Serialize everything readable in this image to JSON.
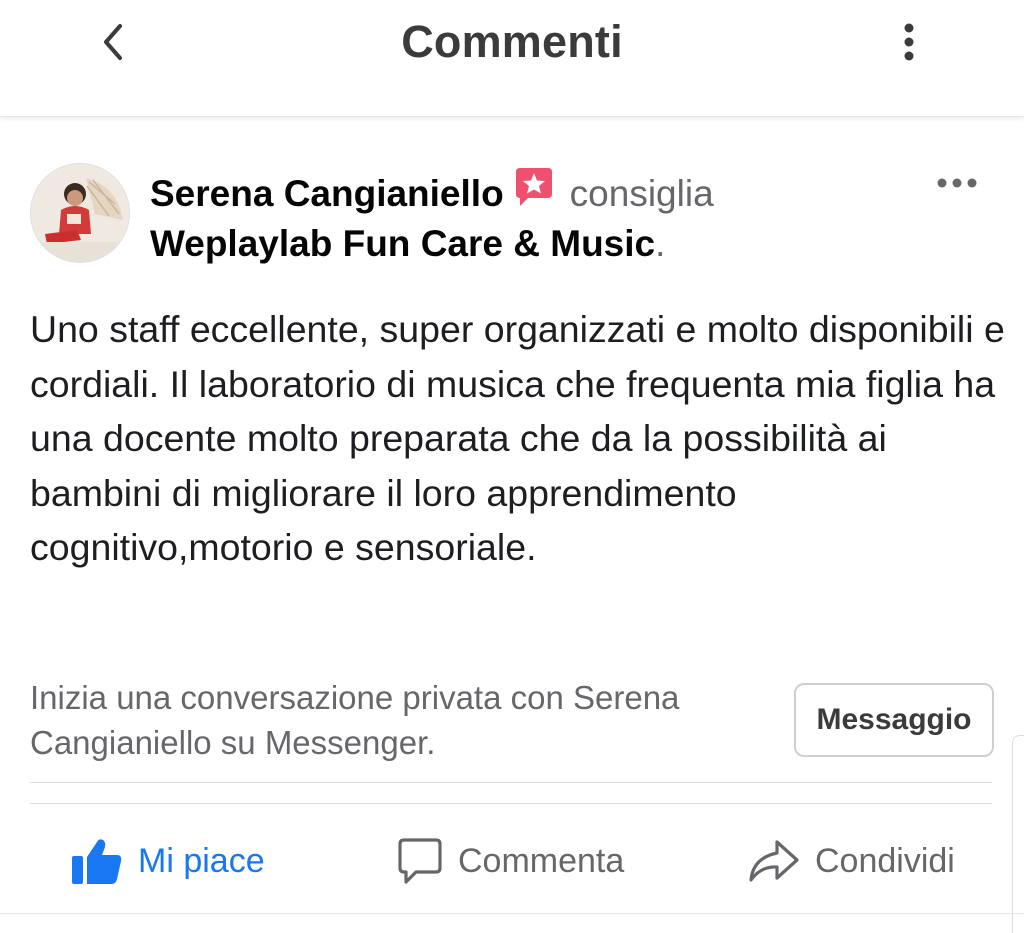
{
  "header": {
    "title": "Commenti",
    "back_icon": "chevron-left-icon",
    "menu_icon": "vertical-ellipsis-icon"
  },
  "post": {
    "author": "Serena Cangianiello",
    "verb": "consiglia",
    "page": "Weplaylab Fun Care & Music",
    "period": ".",
    "recommend_icon": "recommendation-star-icon",
    "more_icon": "horizontal-ellipsis-icon",
    "text": "Uno staff eccellente, super organizzati e molto disponibili e cordiali. Il laboratorio di musica che frequenta mia figlia ha una docente molto preparata che da la possibilità ai bambini di migliorare il loro apprendimento cognitivo,motorio e sensoriale."
  },
  "messenger": {
    "prompt": "Inizia una conversazione privata con Serena Cangianiello su Messenger.",
    "button_label": "Messaggio"
  },
  "actions": {
    "like": "Mi piace",
    "comment": "Commenta",
    "share": "Condividi"
  },
  "colors": {
    "accent": "#1877f2",
    "recommend": "#f0506e",
    "secondary_text": "#65676b"
  }
}
